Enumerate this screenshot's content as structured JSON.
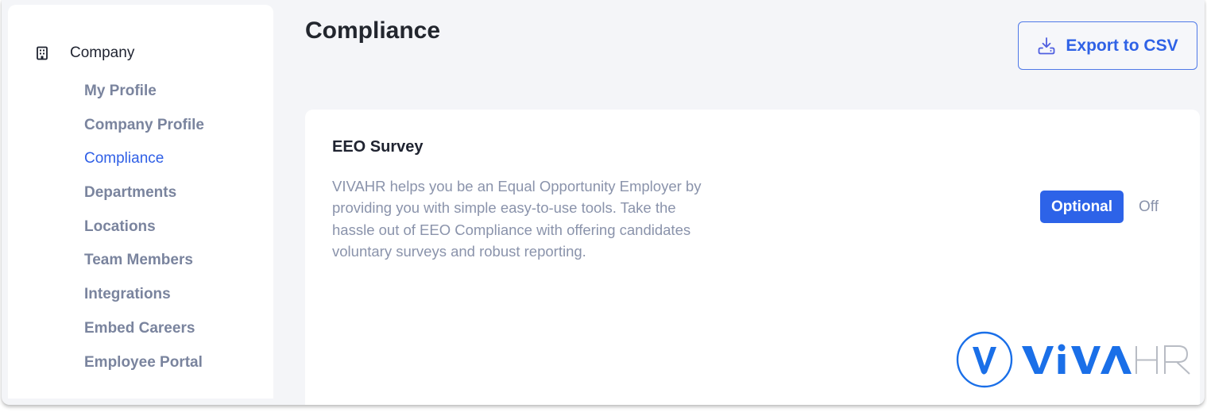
{
  "sidebar": {
    "section": {
      "icon": "building-icon",
      "label": "Company"
    },
    "items": [
      {
        "label": "My Profile",
        "active": false
      },
      {
        "label": "Company Profile",
        "active": false
      },
      {
        "label": "Compliance",
        "active": true
      },
      {
        "label": "Departments",
        "active": false
      },
      {
        "label": "Locations",
        "active": false
      },
      {
        "label": "Team Members",
        "active": false
      },
      {
        "label": "Integrations",
        "active": false
      },
      {
        "label": "Embed Careers",
        "active": false
      },
      {
        "label": "Employee Portal",
        "active": false
      }
    ]
  },
  "header": {
    "title": "Compliance",
    "export_button": {
      "icon": "download-icon",
      "label": "Export to CSV"
    }
  },
  "eeo_card": {
    "title": "EEO Survey",
    "description": "VIVAHR helps you be an Equal Opportunity Employer by providing you with simple easy-to-use tools. Take the hassle out of EEO Compliance with offering candidates voluntary surveys and robust reporting.",
    "options": [
      {
        "label": "Optional",
        "selected": true
      },
      {
        "label": "Off",
        "selected": false
      }
    ]
  },
  "branding": {
    "logo_text_primary": "VIVA",
    "logo_text_secondary": "HR",
    "brand_color": "#1a6fe8",
    "accent_color": "#2d63e8"
  }
}
